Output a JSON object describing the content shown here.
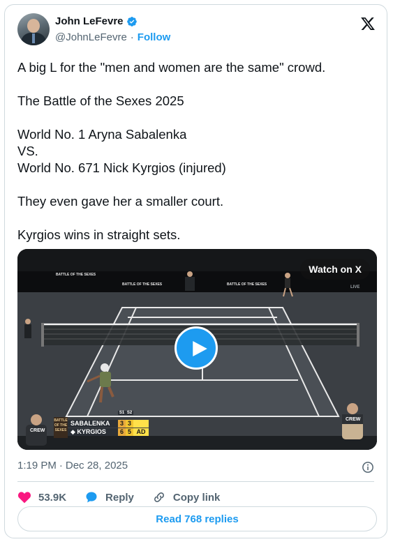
{
  "author": {
    "display_name": "John LeFevre",
    "handle": "@JohnLeFevre",
    "follow_label": "Follow"
  },
  "tweet": {
    "line1": "A big L for the \"men and women are the same\" crowd.",
    "line2": "The Battle of the Sexes 2025",
    "line3a": "World No. 1 Aryna Sabalenka",
    "line3b": "VS.",
    "line3c": "World No. 671 Nick Kyrgios (injured)",
    "line4": "They even gave her a smaller court.",
    "line5": "Kyrgios wins in straight sets."
  },
  "media": {
    "watch_label": "Watch on X",
    "scoreboard": {
      "event_tag": "BATTLE OF THE SEXES",
      "col1": "S1",
      "col2": "S2",
      "player1": "SABALENKA",
      "player1_s1": "3",
      "player1_s2": "3",
      "player1_pt": "",
      "player2": "◆ KYRGIOS",
      "player2_s1": "6",
      "player2_s2": "5",
      "player2_pt": "AD"
    },
    "signs": [
      "BATTLE OF THE SEXES",
      "BATTLE OF THE SEXES",
      "BATTLE OF THE SEXES"
    ],
    "crew1": "CREW",
    "crew2": "CREW",
    "live": "LIVE"
  },
  "meta": {
    "time": "1:19 PM",
    "sep": "·",
    "date": "Dec 28, 2025"
  },
  "actions": {
    "likes": "53.9K",
    "reply_label": "Reply",
    "copy_label": "Copy link"
  },
  "read_replies_label": "Read 768 replies",
  "colors": {
    "accent": "#1d9bf0",
    "like": "#f91880",
    "muted": "#536471"
  }
}
